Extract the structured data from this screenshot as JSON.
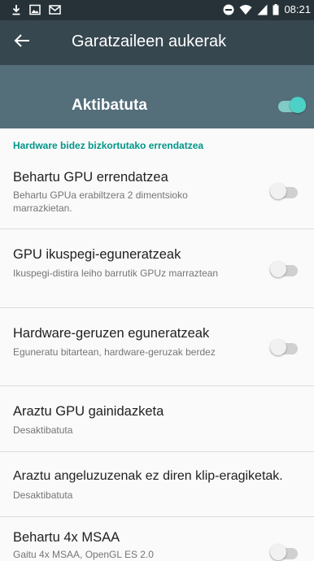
{
  "status_bar": {
    "time": "08:21",
    "icons": [
      "download-icon",
      "image-icon",
      "mail-icon",
      "do-not-disturb-icon",
      "wifi-icon",
      "signal-icon",
      "battery-icon"
    ]
  },
  "toolbar": {
    "back_icon": "arrow-back-icon",
    "title": "Garatzaileen aukerak"
  },
  "master_switch": {
    "label": "Aktibatuta",
    "enabled": true
  },
  "category": {
    "title": "Hardware bidez bizkortutako errendatzea"
  },
  "preferences": [
    {
      "title": "Behartu GPU errendatzea",
      "summary": "Behartu GPUa erabiltzera 2 dimentsioko marrazkietan.",
      "has_switch": true,
      "checked": false
    },
    {
      "title": "GPU ikuspegi-eguneratzeak",
      "summary": "Ikuspegi-distira leiho barrutik GPUz marraztean",
      "has_switch": true,
      "checked": false
    },
    {
      "title": "Hardware-geruzen eguneratzeak",
      "summary": "Eguneratu bitartean, hardware-geruzak berdez",
      "has_switch": true,
      "checked": false
    },
    {
      "title": "Araztu GPU gainidazketa",
      "summary": "Desaktibatuta",
      "has_switch": false
    },
    {
      "title": "Araztu angeluzuzenak ez diren klip-eragiketak.",
      "summary": "Desaktibatuta",
      "has_switch": false
    },
    {
      "title": "Behartu 4x MSAA",
      "summary": "Gaitu 4x MSAA, OpenGL ES 2.0",
      "has_switch": true,
      "checked": false
    }
  ],
  "colors": {
    "status_bar": "#263238",
    "toolbar": "#37474f",
    "master_bar": "#546e7a",
    "accent": "#009688"
  }
}
